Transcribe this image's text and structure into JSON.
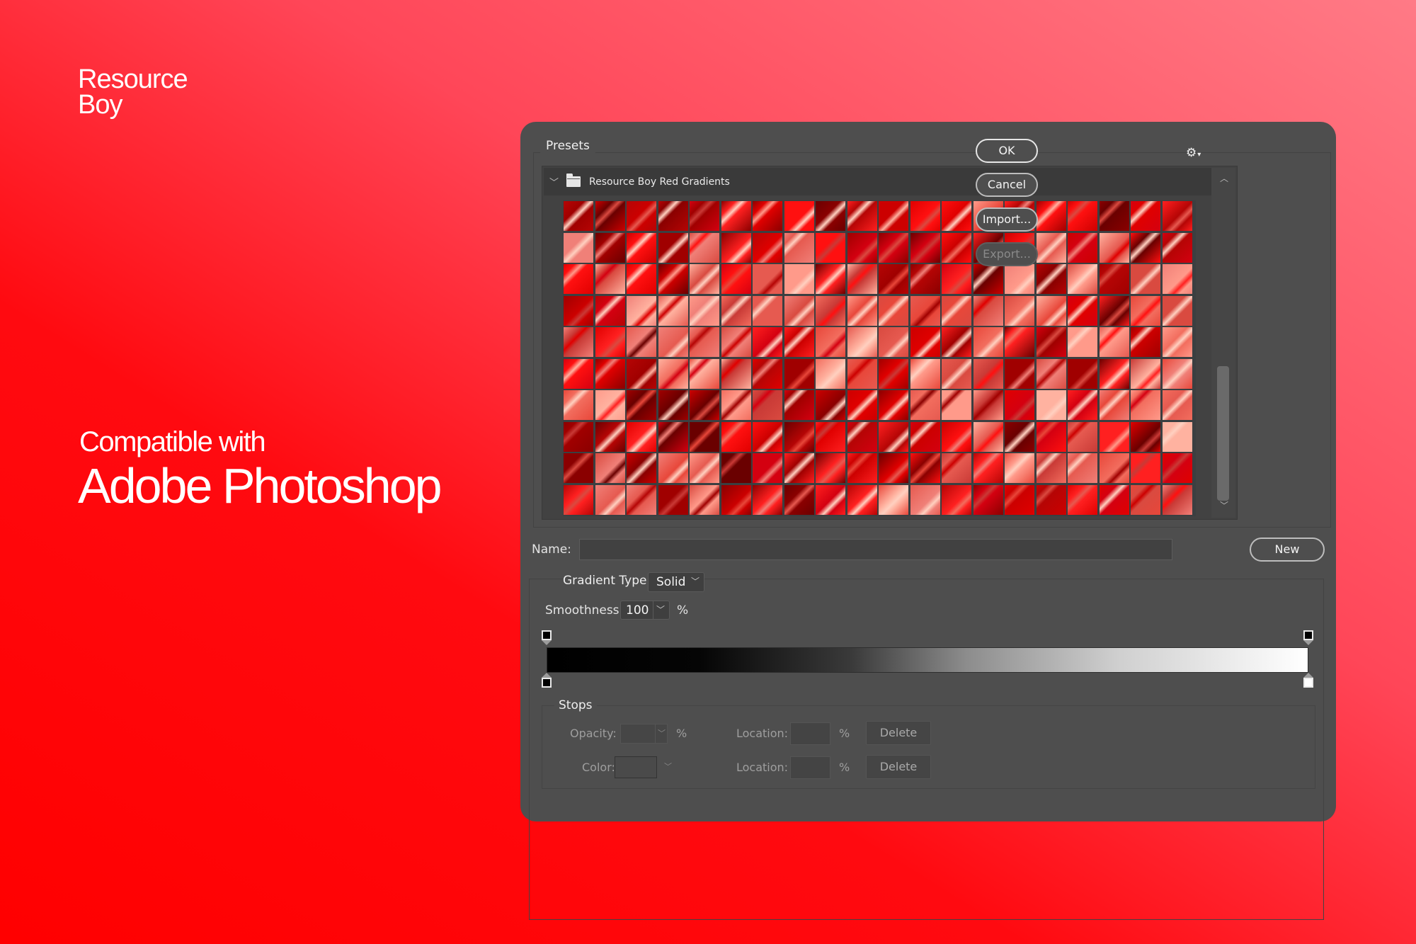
{
  "brand": {
    "line1": "Resource",
    "line2": "Boy"
  },
  "tagline": {
    "line1": "Compatible with",
    "line2": "Adobe Photoshop"
  },
  "dialog": {
    "presets_label": "Presets",
    "gear_icon": "gear-icon",
    "folder": {
      "expanded": true,
      "name": "Resource Boy Red Gradients"
    },
    "swatch_grid": {
      "columns": 20,
      "rows": 10
    },
    "buttons": {
      "ok": "OK",
      "cancel": "Cancel",
      "import": "Import...",
      "export": "Export...",
      "new": "New"
    },
    "name_label": "Name:",
    "name_value": "",
    "gradient_type_label": "Gradient Type:",
    "gradient_type_value": "Solid",
    "smoothness_label": "Smoothness:",
    "smoothness_value": "100",
    "percent": "%",
    "gradient_bar": {
      "from": "#000000",
      "to": "#ffffff"
    },
    "stops": {
      "label": "Stops",
      "opacity_label": "Opacity:",
      "opacity_value": "",
      "color_label": "Color:",
      "location_label": "Location:",
      "location1_value": "",
      "location2_value": "",
      "delete_label": "Delete"
    }
  },
  "colors": {
    "bg_start": "#ff0000",
    "bg_end": "#ff7a86",
    "dialog_bg": "#4e4e4e"
  }
}
